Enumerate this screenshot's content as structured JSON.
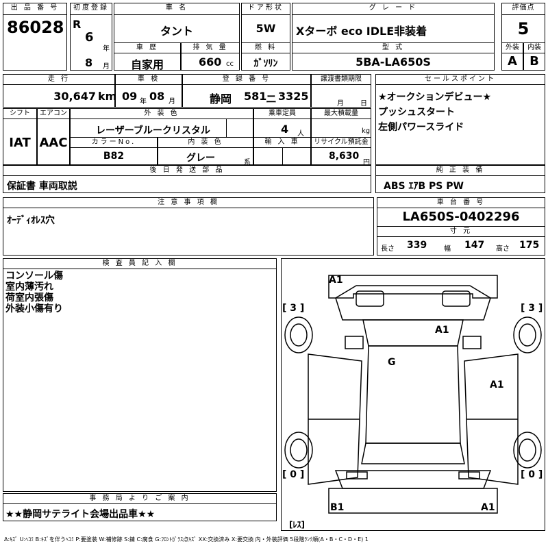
{
  "header": {
    "lot_label": "出 品 番 号",
    "lot": "86028",
    "first_reg_label": "初度登録",
    "era": "R",
    "year": "6",
    "year_unit": "年",
    "month": "8",
    "month_unit": "月",
    "car_name_label": "車  名",
    "car_name": "タント",
    "door_label": "ドア形状",
    "door": "5W",
    "grade_label": "グ レ ー ド",
    "grade": "Xターボ  eco  IDLE非装着",
    "score_label": "評価点",
    "score": "5",
    "history_label": "車  歴",
    "history": "自家用",
    "displacement_label": "排 気 量",
    "displacement": "660",
    "cc": "cc",
    "fuel_label": "燃  料",
    "fuel": "ｶﾞｿﾘﾝ",
    "model_label": "型  式",
    "model": "5BA-LA650S",
    "ext_label": "外装",
    "int_label": "内装",
    "ext": "A",
    "int": "B"
  },
  "row2": {
    "mileage_label": "走  行",
    "mileage": "30,647",
    "km": "km",
    "inspection_label": "車  検",
    "insp_year": "09",
    "insp_year_unit": "年",
    "insp_month": "08",
    "insp_month_unit": "月",
    "plate_label": "登 録 番 号",
    "plate_region": "静岡",
    "plate_class": "581",
    "plate_kana": "ニ",
    "plate_num": "3325",
    "transfer_label": "譲渡書類期限",
    "transfer_month_unit": "月",
    "transfer_day_unit": "日",
    "shift_label": "シフト",
    "shift": "IAT",
    "ac_label": "エアコン",
    "ac": "AAC",
    "color_label": "外 装 色",
    "color": "レーザーブルークリスタル",
    "capacity_label": "乗車定員",
    "capacity": "4",
    "capacity_unit": "人",
    "load_label": "最大積載量",
    "load_unit": "kg",
    "color_no_label": "カラーNo.",
    "color_no": "B82",
    "int_color_label": "内 装 色",
    "int_color": "グレー",
    "int_color_suffix": "系",
    "import_label": "輸 入 車",
    "recycle_label": "リサイクル預託金",
    "recycle": "8,630",
    "recycle_unit": "円"
  },
  "sales": {
    "label": "セールスポイント",
    "items": [
      "★オークションデビュー★",
      "プッシュスタート",
      "左側パワースライド"
    ]
  },
  "parts": {
    "label": "後 日 発 送 部 品",
    "value": "保証書 車両取説"
  },
  "equip": {
    "label": "純 正 装 備",
    "value": "ABS ｴｱB PS PW"
  },
  "notes": {
    "label": "注 意 事 項 欄",
    "value": "ｵｰﾃﾞｨｵﾚｽ穴"
  },
  "chassis": {
    "label": "車 台 番 号",
    "value": "LA650S-0402296"
  },
  "dims": {
    "label": "寸 元",
    "length_label": "長さ",
    "length": "339",
    "width_label": "幅",
    "width": "147",
    "height_label": "高さ",
    "height": "175"
  },
  "inspector": {
    "label": "検 査 員 記 入 欄",
    "items": [
      "コンソール傷",
      "室内薄汚れ",
      "荷室内張傷",
      "外装小傷有り"
    ]
  },
  "office": {
    "label": "事 務 局 よ り ご 案 内",
    "value": "★★静岡サテライト会場出品車★★"
  },
  "diagram": {
    "marks": [
      "A1",
      "A1",
      "G",
      "A1",
      "B1",
      "A1"
    ],
    "tires": [
      "[ 3 ]",
      "[ 3 ]",
      "[ 0 ]",
      "[ 0 ]"
    ],
    "spare": "[ﾚｽ]"
  },
  "legend": "A:ｷｽﾞ  U:ﾍｺﾐ  B:ｷｽﾞを伴うﾍｺﾐ  P:要塗装  W:補修跡  S:錆  C:腐食  G:ﾌﾛﾝﾄｶﾞﾗｽ点ｷｽﾞ  XX:交換済み  X:要交換   内・外装評価  5段階ﾗﾝｸ順(A・B・C・D・E) 1"
}
